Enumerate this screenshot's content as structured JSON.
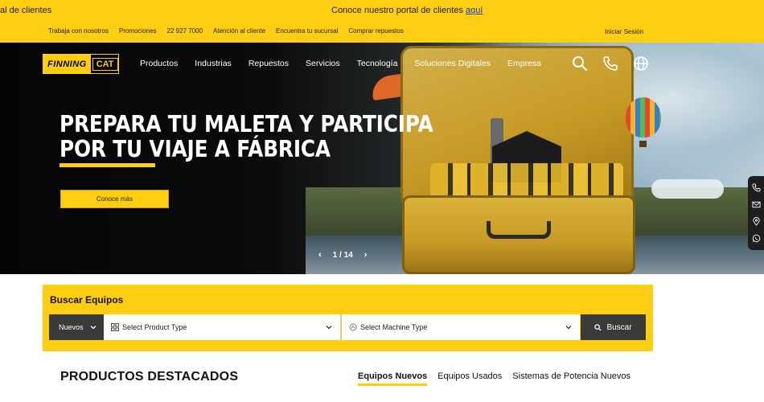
{
  "announcement": {
    "left_text": "al de clientes",
    "center_text": "Conoce nuestro portal de clientes",
    "center_link": "aquí"
  },
  "utility_links": [
    "Trabaja con nosotros",
    "Promociones",
    "22 927 7000",
    "Atención al cliente",
    "Encuentra tu sucursal",
    "Comprar repuestos"
  ],
  "login_label": "Iniciar Sesión",
  "logo": {
    "brand": "FINNING",
    "cat": "CAT"
  },
  "nav": [
    "Productos",
    "Industrias",
    "Repuestos",
    "Servicios",
    "Tecnología",
    "Soluciones Digitales",
    "Empresa"
  ],
  "nav_icons": [
    "search-icon",
    "phone-icon",
    "globe-icon"
  ],
  "hero": {
    "title_line1": "PREPARA TU MALETA Y PARTICIPA",
    "title_line2": "POR TU VIAJE A FÁBRICA",
    "cta_label": "Conoce más",
    "pager_text": "1 / 14",
    "prev": "‹",
    "next": "›"
  },
  "side_contact_icons": [
    "phone-icon",
    "mail-icon",
    "location-icon",
    "whatsapp-icon"
  ],
  "search": {
    "title": "Buscar Equipos",
    "condition_value": "Nuevos",
    "product_type_placeholder": "Select Product Type",
    "machine_type_placeholder": "Select Machine Type",
    "button_label": "Buscar"
  },
  "featured": {
    "title": "PRODUCTOS DESTACADOS",
    "tabs": [
      "Equipos Nuevos",
      "Equipos Usados",
      "Sistemas de Potencia Nuevos"
    ],
    "active_tab": "Equipos Nuevos"
  },
  "colors": {
    "brand_yellow": "#ffcd11",
    "dark": "#3a3a3a",
    "link_blue": "#1a3bd1"
  }
}
